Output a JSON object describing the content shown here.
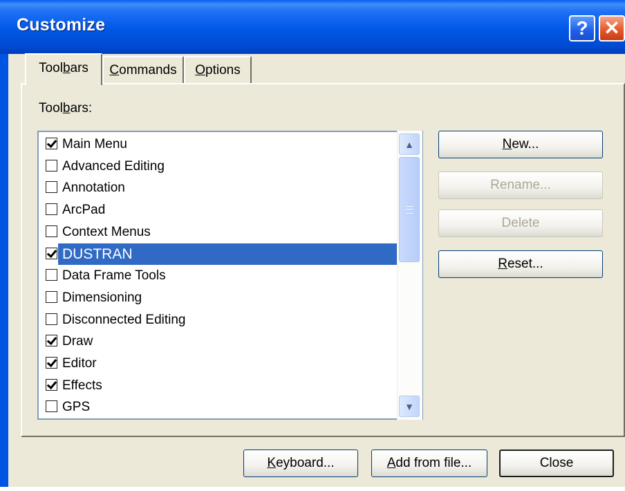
{
  "window": {
    "title": "Customize"
  },
  "titlebar_buttons": {
    "help_glyph": "?",
    "close_glyph": "✕"
  },
  "tabs": [
    {
      "pre": "Tool",
      "key": "b",
      "post": "ars",
      "active": true
    },
    {
      "pre": "",
      "key": "C",
      "post": "ommands",
      "active": false
    },
    {
      "pre": "",
      "key": "O",
      "post": "ptions",
      "active": false
    }
  ],
  "list": {
    "label_pre": "Tool",
    "label_key": "b",
    "label_post": "ars:",
    "items": [
      {
        "label": "Main Menu",
        "checked": true,
        "selected": false
      },
      {
        "label": "Advanced Editing",
        "checked": false,
        "selected": false
      },
      {
        "label": "Annotation",
        "checked": false,
        "selected": false
      },
      {
        "label": "ArcPad",
        "checked": false,
        "selected": false
      },
      {
        "label": "Context Menus",
        "checked": false,
        "selected": false
      },
      {
        "label": "DUSTRAN",
        "checked": true,
        "selected": true
      },
      {
        "label": "Data Frame Tools",
        "checked": false,
        "selected": false
      },
      {
        "label": "Dimensioning",
        "checked": false,
        "selected": false
      },
      {
        "label": "Disconnected Editing",
        "checked": false,
        "selected": false
      },
      {
        "label": "Draw",
        "checked": true,
        "selected": false
      },
      {
        "label": "Editor",
        "checked": true,
        "selected": false
      },
      {
        "label": "Effects",
        "checked": true,
        "selected": false
      },
      {
        "label": "GPS",
        "checked": false,
        "selected": false
      }
    ]
  },
  "side_buttons": {
    "new": {
      "key": "N",
      "post": "ew...",
      "enabled": true
    },
    "rename": {
      "label": "Rename...",
      "enabled": false
    },
    "delete": {
      "label": "Delete",
      "enabled": false
    },
    "reset": {
      "key": "R",
      "post": "eset...",
      "enabled": true
    }
  },
  "bottom_buttons": {
    "keyboard": {
      "key": "K",
      "post": "eyboard..."
    },
    "add_from_file": {
      "key": "A",
      "post": "dd from file..."
    },
    "close": {
      "label": "Close"
    }
  },
  "colors": {
    "selection": "#316ac5",
    "titlebar": "#0054e3",
    "face": "#ece9d8"
  }
}
